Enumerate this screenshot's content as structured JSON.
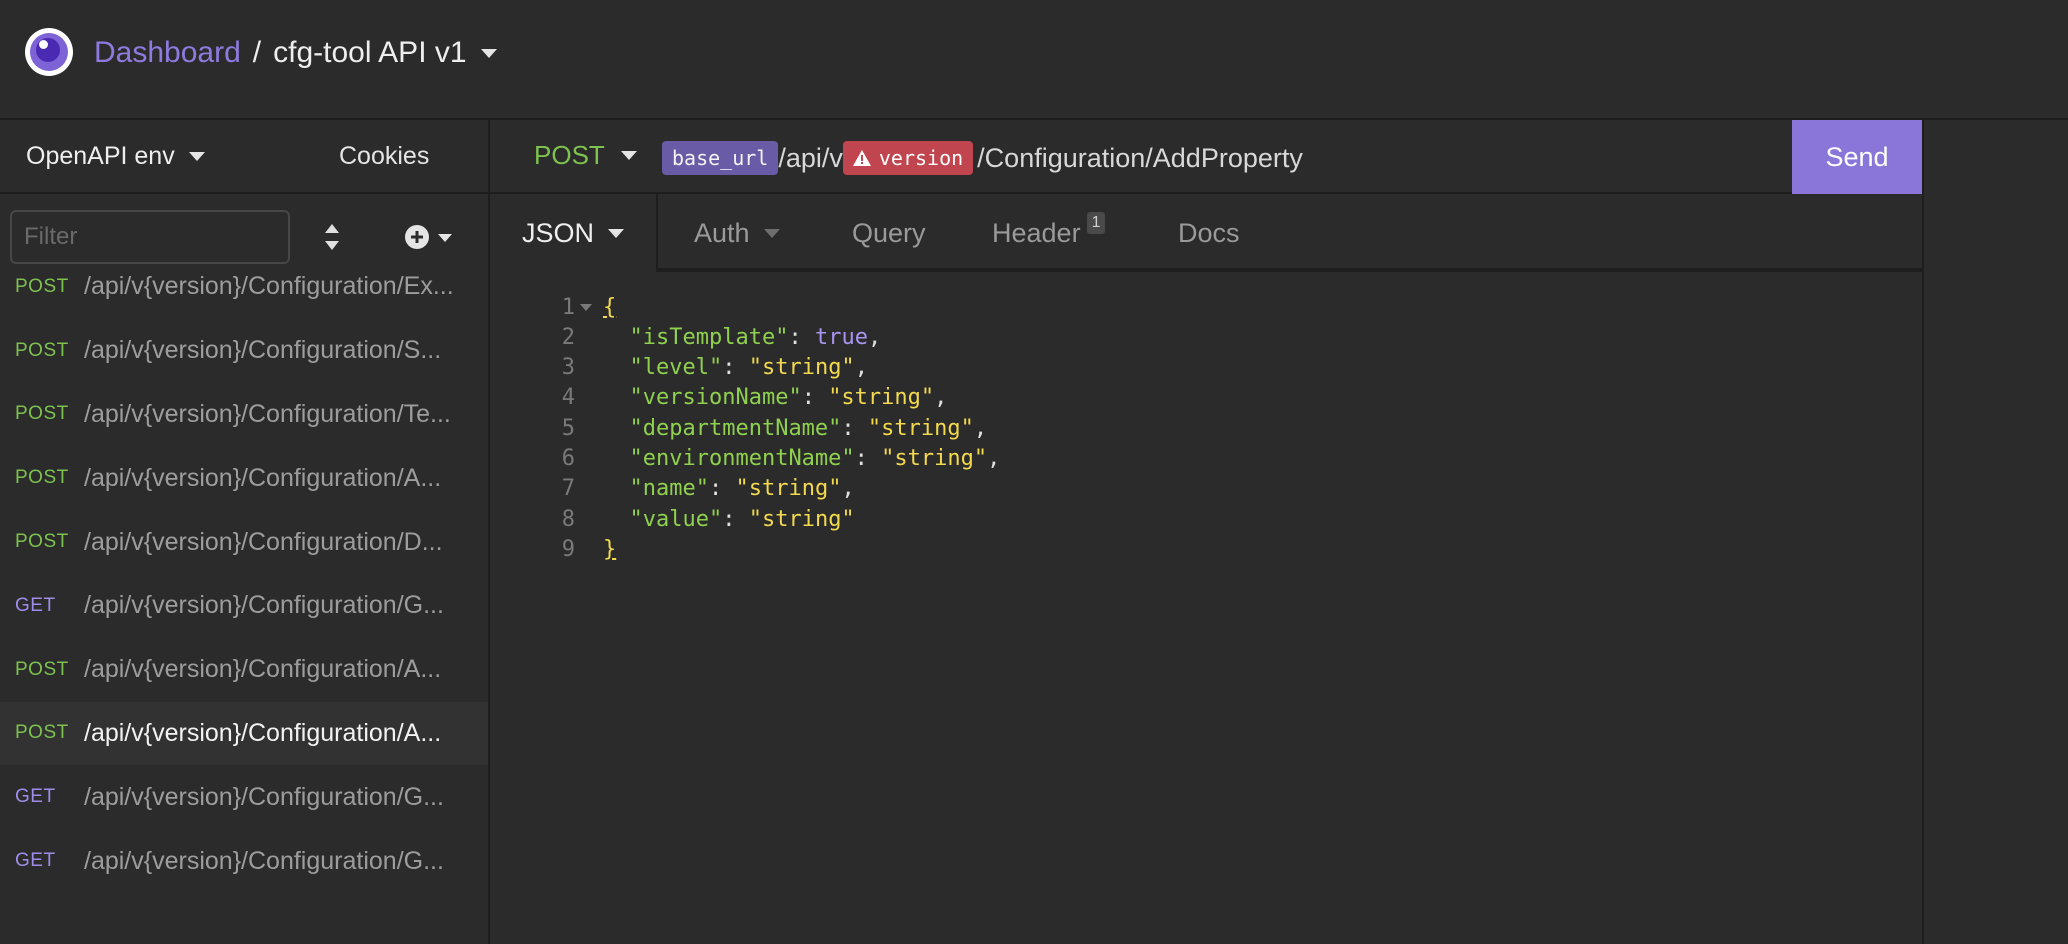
{
  "header": {
    "breadcrumb_root": "Dashboard",
    "separator": "/",
    "project": "cfg-tool API v1"
  },
  "sidebar": {
    "environment": "OpenAPI env",
    "cookies": "Cookies",
    "filter_placeholder": "Filter",
    "requests": [
      {
        "method": "POST",
        "path": "/api/v{version}/Configuration/Ex..."
      },
      {
        "method": "POST",
        "path": "/api/v{version}/Configuration/S..."
      },
      {
        "method": "POST",
        "path": "/api/v{version}/Configuration/Te..."
      },
      {
        "method": "POST",
        "path": "/api/v{version}/Configuration/A..."
      },
      {
        "method": "POST",
        "path": "/api/v{version}/Configuration/D..."
      },
      {
        "method": "GET",
        "path": "/api/v{version}/Configuration/G..."
      },
      {
        "method": "POST",
        "path": "/api/v{version}/Configuration/A..."
      },
      {
        "method": "POST",
        "path": "/api/v{version}/Configuration/A...",
        "active": true
      },
      {
        "method": "GET",
        "path": "/api/v{version}/Configuration/G..."
      },
      {
        "method": "GET",
        "path": "/api/v{version}/Configuration/G..."
      }
    ]
  },
  "request": {
    "method": "POST",
    "url_var": "base_url",
    "url_mid": "/api/v",
    "url_err_var": "version",
    "url_tail": "/Configuration/AddProperty",
    "send_label": "Send"
  },
  "tabs": {
    "body": "JSON",
    "auth": "Auth",
    "query": "Query",
    "header": "Header",
    "header_count": "1",
    "docs": "Docs"
  },
  "editor": {
    "line_numbers": [
      "1",
      "2",
      "3",
      "4",
      "5",
      "6",
      "7",
      "8",
      "9"
    ],
    "open_brace": "{",
    "close_brace": "}",
    "fields": [
      {
        "key": "\"isTemplate\"",
        "value": "true",
        "type": "bool"
      },
      {
        "key": "\"level\"",
        "value": "\"string\"",
        "type": "string"
      },
      {
        "key": "\"versionName\"",
        "value": "\"string\"",
        "type": "string"
      },
      {
        "key": "\"departmentName\"",
        "value": "\"string\"",
        "type": "string"
      },
      {
        "key": "\"environmentName\"",
        "value": "\"string\"",
        "type": "string"
      },
      {
        "key": "\"name\"",
        "value": "\"string\"",
        "type": "string"
      },
      {
        "key": "\"value\"",
        "value": "\"string\"",
        "type": "string"
      }
    ]
  },
  "colors": {
    "accent": "#8a76d9",
    "post": "#7dc24e",
    "get": "#9f8cea",
    "error": "#c0454e"
  }
}
